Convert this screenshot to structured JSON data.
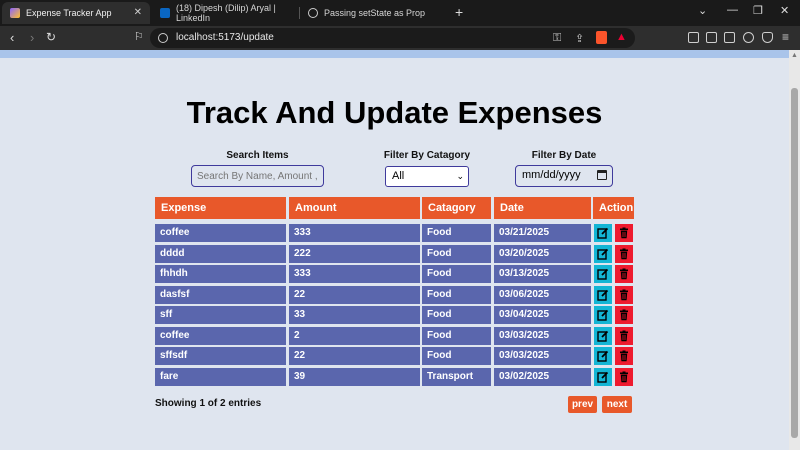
{
  "browser": {
    "tabs": [
      {
        "title": "Expense Tracker App",
        "active": true
      },
      {
        "title": "(18) Dipesh (Dilip) Aryal | LinkedIn",
        "active": false
      },
      {
        "title": "Passing setState as Prop",
        "active": false
      }
    ],
    "new_tab": "+",
    "url": "localhost:5173/update"
  },
  "page": {
    "title": "Track And Update Expenses",
    "filters": {
      "search_label": "Search Items",
      "search_placeholder": "Search By Name, Amount ,",
      "category_label": "Filter By Catagory",
      "category_value": "All",
      "date_label": "Filter By Date",
      "date_placeholder": "mm/dd/yyyy"
    },
    "table": {
      "headers": [
        "Expense",
        "Amount",
        "Catagory",
        "Date",
        "Action"
      ],
      "rows": [
        {
          "expense": "coffee",
          "amount": "333",
          "category": "Food",
          "date": "03/21/2025"
        },
        {
          "expense": "dddd",
          "amount": "222",
          "category": "Food",
          "date": "03/20/2025"
        },
        {
          "expense": "fhhdh",
          "amount": "333",
          "category": "Food",
          "date": "03/13/2025"
        },
        {
          "expense": "dasfsf",
          "amount": "22",
          "category": "Food",
          "date": "03/06/2025"
        },
        {
          "expense": "sff",
          "amount": "33",
          "category": "Food",
          "date": "03/04/2025"
        },
        {
          "expense": "coffee",
          "amount": "2",
          "category": "Food",
          "date": "03/03/2025"
        },
        {
          "expense": "sffsdf",
          "amount": "22",
          "category": "Food",
          "date": "03/03/2025"
        },
        {
          "expense": "fare",
          "amount": "39",
          "category": "Transport",
          "date": "03/02/2025"
        }
      ]
    },
    "pagination": {
      "status": "Showing 1 of 2 entries",
      "prev": "prev",
      "next": "next"
    }
  },
  "colors": {
    "header": "#e8582a",
    "row": "#5a66ad",
    "edit": "#14b5d4",
    "delete": "#ee1b2f",
    "page_bg": "#dfe5ef"
  },
  "icons": {
    "edit": "edit-icon",
    "delete": "trash-icon"
  }
}
